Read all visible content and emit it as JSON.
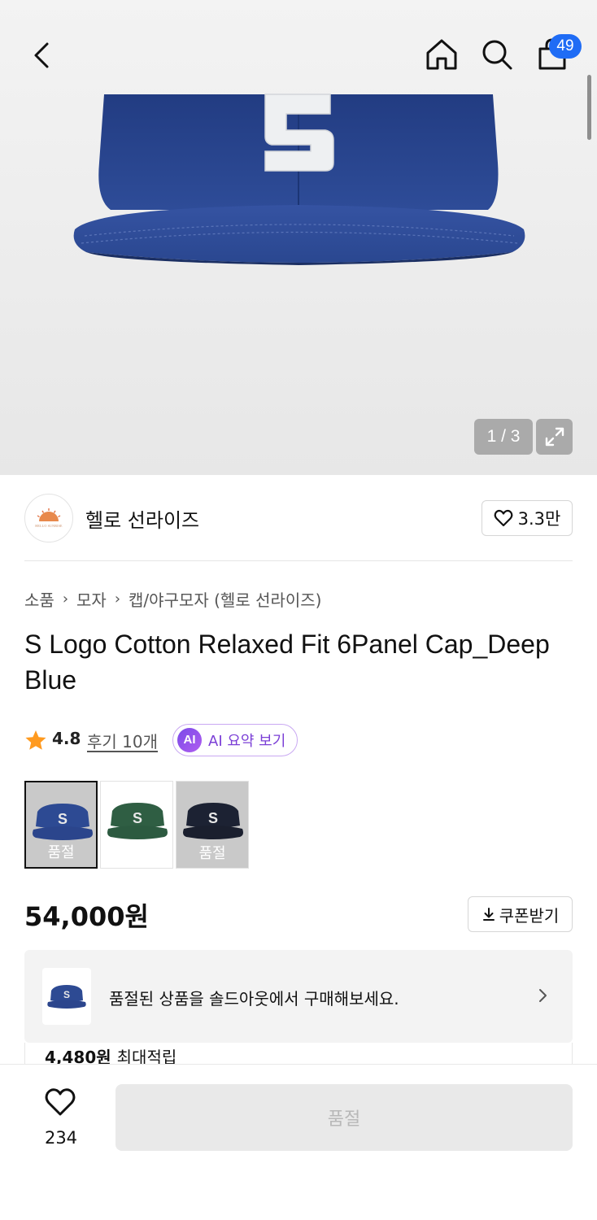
{
  "header": {
    "cart_count": "49",
    "icons": [
      "chevron-left-icon",
      "home-icon",
      "search-icon",
      "shopping-bag-icon"
    ]
  },
  "gallery": {
    "page_indicator": "1 / 3"
  },
  "brand": {
    "name": "헬로 선라이즈",
    "logo_text": "HELLO SUNRISE",
    "like_count": "3.3만"
  },
  "breadcrumb": [
    "소품",
    "모자",
    "캡/야구모자 (헬로 선라이즈)"
  ],
  "product": {
    "title": "S Logo Cotton Relaxed Fit 6Panel Cap_Deep Blue",
    "rating": "4.8",
    "review_label": "후기 10개",
    "ai_badge": "AI",
    "ai_summary_label": "AI 요약 보기",
    "price": "54,000원",
    "coupon_label": "쿠폰받기"
  },
  "colors": [
    {
      "name": "deep-blue",
      "hex": "#2d4a93",
      "label": "품절",
      "selected": true,
      "soldout": true
    },
    {
      "name": "green",
      "hex": "#2f5e43",
      "label": "",
      "selected": false,
      "soldout": false
    },
    {
      "name": "navy",
      "hex": "#1c2233",
      "label": "품절",
      "selected": false,
      "soldout": true
    }
  ],
  "soldout_banner": {
    "text": "품절된 상품을 솔드아웃에서 구매해보세요."
  },
  "points": {
    "amount": "4,480원",
    "suffix": "최대적립"
  },
  "bottom_bar": {
    "wish_count": "234",
    "buy_button_label": "품절"
  },
  "theme": {
    "accent_blue": "#1f6cf5",
    "ai_purple": "#7b3fd6",
    "cap_blue": "#2d4a93",
    "star_orange": "#ff9a1f"
  }
}
